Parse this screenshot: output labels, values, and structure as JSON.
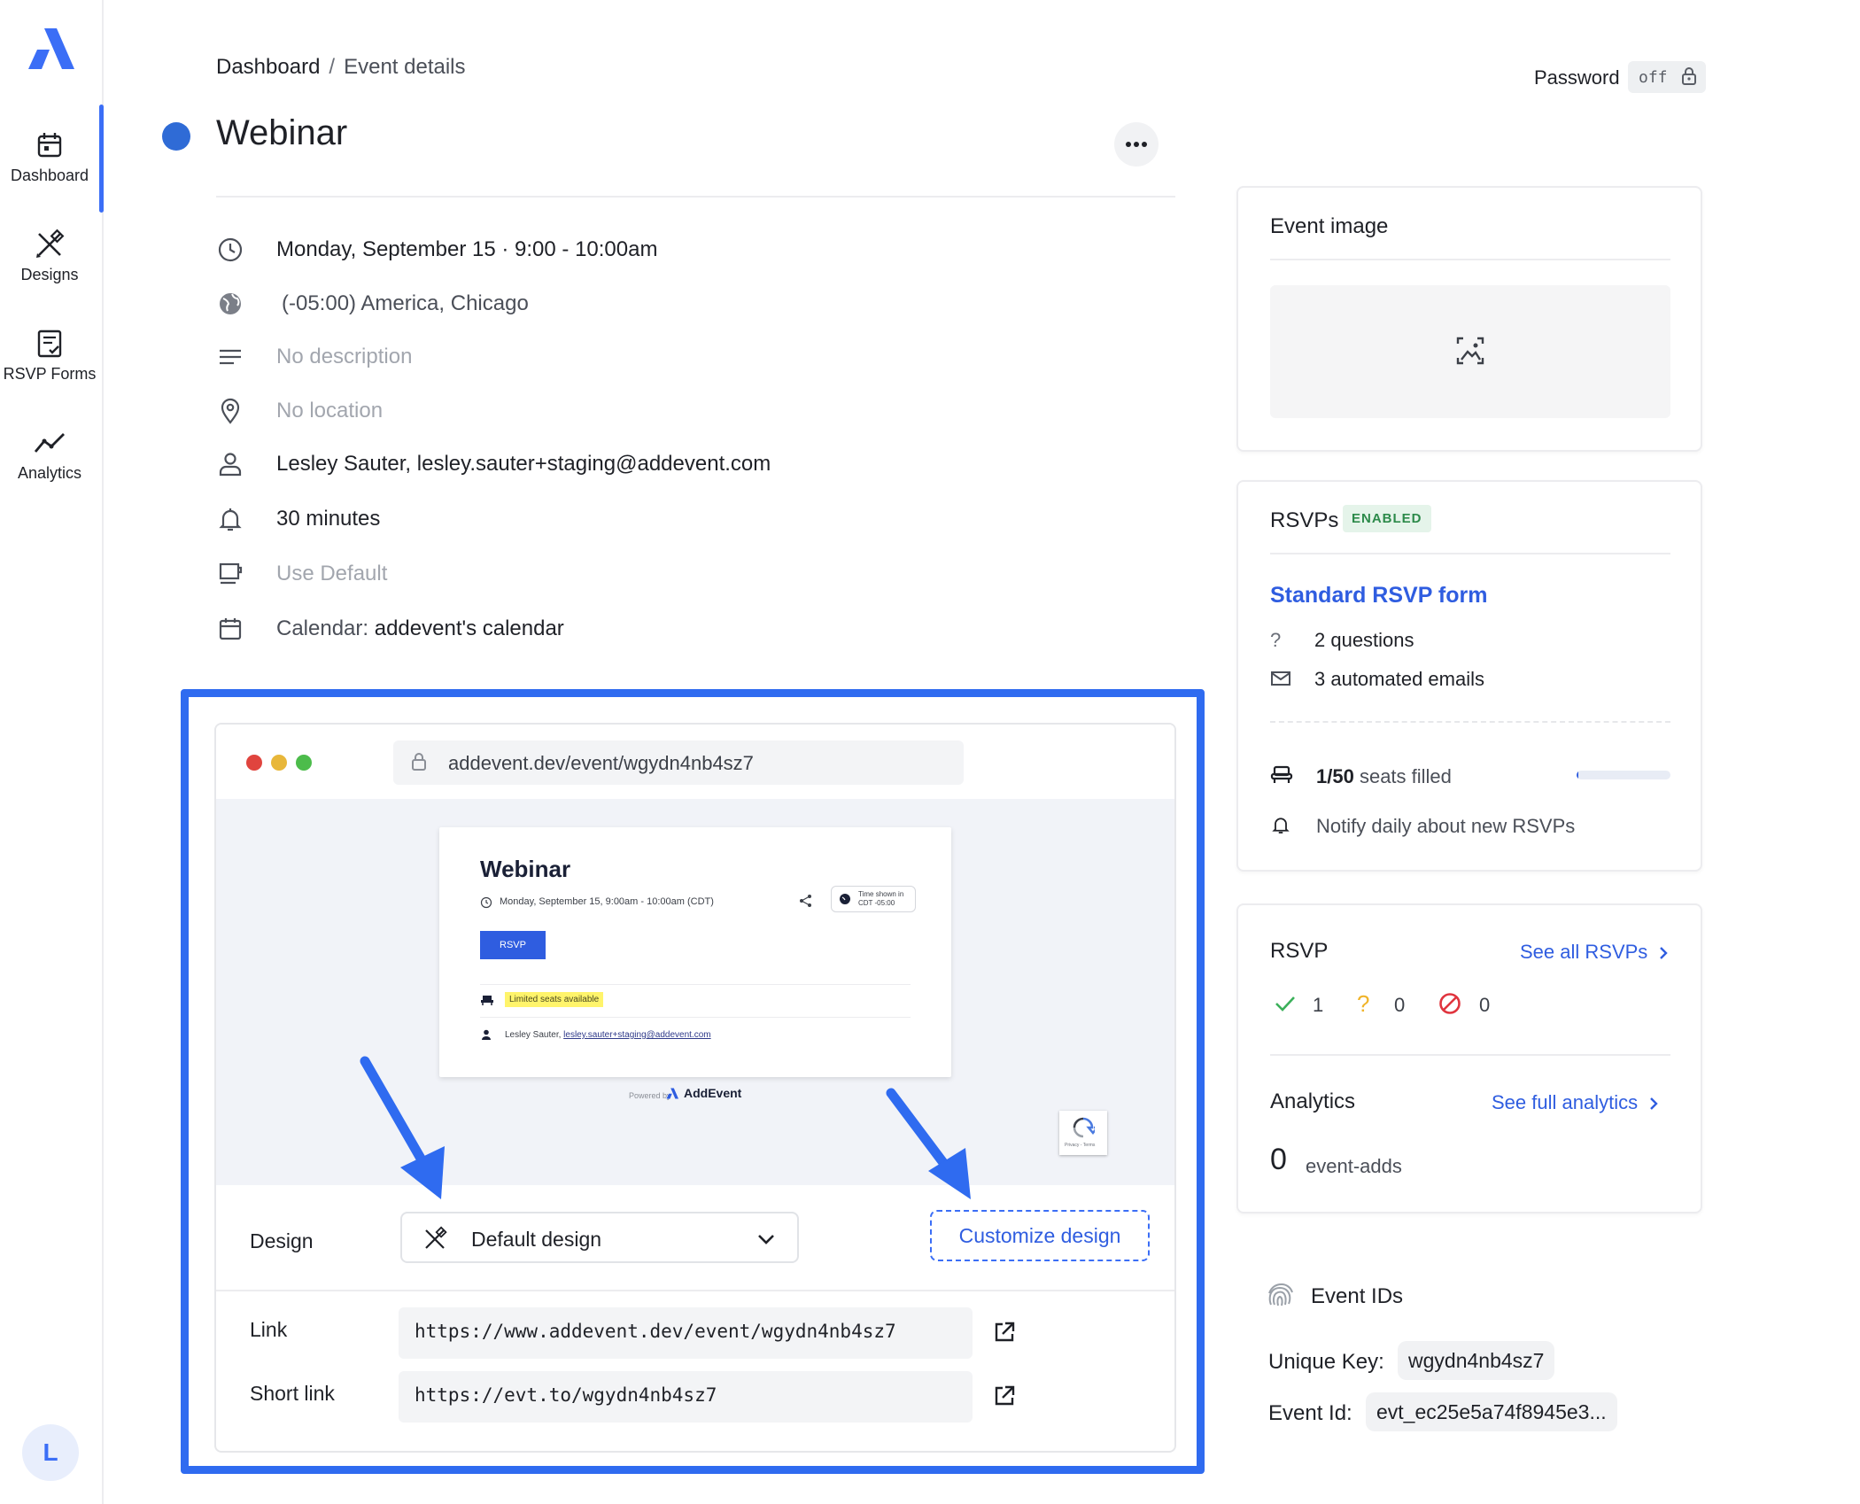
{
  "sidebar": {
    "items": [
      {
        "label": "Dashboard",
        "icon": "calendar-icon"
      },
      {
        "label": "Designs",
        "icon": "design-tools-icon"
      },
      {
        "label": "RSVP Forms",
        "icon": "form-check-icon"
      },
      {
        "label": "Analytics",
        "icon": "trend-line-icon"
      }
    ],
    "avatar_initial": "L"
  },
  "breadcrumb": {
    "root": "Dashboard",
    "separator": "/",
    "current": "Event details"
  },
  "event": {
    "title": "Webinar",
    "color": "#2f6bd6",
    "date_time": "Monday, September 15 · 9:00 - 10:00am",
    "timezone": "(-05:00) America, Chicago",
    "description": "No description",
    "location": "No location",
    "organizer": "Lesley Sauter, lesley.sauter+staging@addevent.com",
    "reminder": "30 minutes",
    "template": "Use Default",
    "calendar_label": "Calendar:",
    "calendar_value": "addevent's calendar"
  },
  "password": {
    "label": "Password",
    "state": "off"
  },
  "preview": {
    "url": "addevent.dev/event/wgydn4nb4sz7",
    "mini": {
      "title": "Webinar",
      "date": "Monday, September 15, 9:00am - 10:00am (CDT)",
      "tz_line1": "Time shown in",
      "tz_line2": "CDT -05:00",
      "rsvp_button": "RSVP",
      "limited": "Limited seats available",
      "host_name": "Lesley Sauter,",
      "host_email": "lesley.sauter+staging@addevent.com"
    },
    "powered_by": "Powered by",
    "brand": "AddEvent",
    "captcha_text": "Privacy - Terms"
  },
  "design": {
    "label": "Design",
    "selected": "Default design",
    "customize_button": "Customize design",
    "link_label": "Link",
    "link_value": "https://www.addevent.dev/event/wgydn4nb4sz7",
    "short_link_label": "Short link",
    "short_link_value": "https://evt.to/wgydn4nb4sz7"
  },
  "event_image": {
    "title": "Event image"
  },
  "rsvps": {
    "title": "RSVPs",
    "badge": "ENABLED",
    "form_name": "Standard RSVP form",
    "questions": "2 questions",
    "emails": "3 automated emails",
    "seats_count": "1/50",
    "seats_text": "seats filled",
    "seats_fraction": 0.02,
    "notify": "Notify daily about new RSVPs"
  },
  "rsvp_summary": {
    "title": "RSVP",
    "see_all": "See all RSVPs",
    "yes": "1",
    "maybe": "0",
    "no": "0",
    "analytics_title": "Analytics",
    "see_analytics": "See full analytics",
    "event_adds_count": "0",
    "event_adds_label": "event-adds"
  },
  "event_ids": {
    "title": "Event IDs",
    "unique_key_label": "Unique Key:",
    "unique_key": "wgydn4nb4sz7",
    "event_id_label": "Event Id:",
    "event_id": "evt_ec25e5a74f8945e3..."
  },
  "colors": {
    "accent": "#3b6ef6",
    "highlight": "#2f6bf0",
    "enabled_green": "#2c8a4a"
  }
}
